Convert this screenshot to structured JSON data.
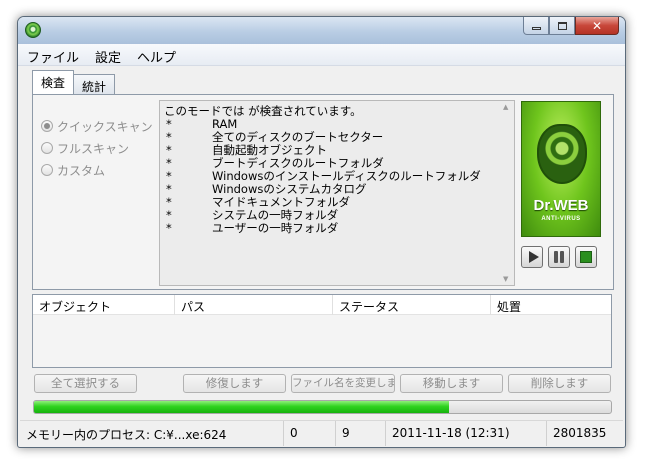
{
  "window": {
    "title": ""
  },
  "menu": [
    "ファイル",
    "設定",
    "ヘルプ"
  ],
  "tabs": [
    "検査",
    "統計"
  ],
  "scan_modes": [
    {
      "label": "クイックスキャン",
      "checked": true
    },
    {
      "label": "フルスキャン",
      "checked": false
    },
    {
      "label": "カスタム",
      "checked": false
    }
  ],
  "info": {
    "title": "このモードでは が検査されています。",
    "bullet": "*",
    "items": [
      "RAM",
      "全てのディスクのブートセクター",
      "自動起動オブジェクト",
      "ブートディスクのルートフォルダ",
      "Windowsのインストールディスクのルートフォルダ",
      "Windowsのシステムカタログ",
      "マイドキュメントフォルダ",
      "システムの一時フォルダ",
      "ユーザーの一時フォルダ"
    ]
  },
  "logo": {
    "name": "Dr.WEB",
    "sub": "ANTI-VIRUS"
  },
  "table": {
    "columns": [
      "オブジェクト",
      "パス",
      "ステータス",
      "処置"
    ]
  },
  "actions": [
    "全て選択する",
    "修復します",
    "ファイル名を変更します",
    "移動します",
    "削除します"
  ],
  "progress": {
    "percent": 72,
    "color": "#2fd31f"
  },
  "status": {
    "process": "メモリー内のプロセス: C:¥...xe:624",
    "count1": "0",
    "count2": "9",
    "datetime": "2011-11-18 (12:31)",
    "total": "2801835"
  }
}
